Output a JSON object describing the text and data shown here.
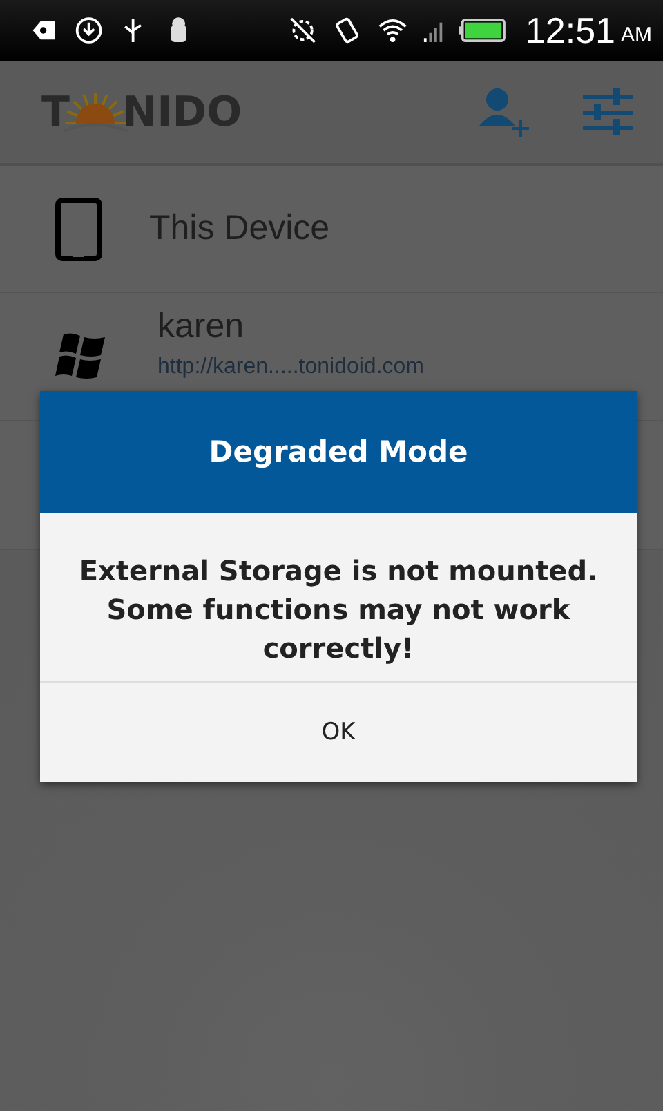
{
  "status_bar": {
    "time": "12:51",
    "meridiem": "AM"
  },
  "app_bar": {
    "logo": {
      "left": "T",
      "right": "NIDO"
    }
  },
  "devices": [
    {
      "kind": "tablet",
      "name": "This Device"
    },
    {
      "kind": "windows",
      "name": "karen",
      "url": "http://karen.....tonidoid.com"
    },
    {
      "kind": "empty"
    }
  ],
  "dialog": {
    "title": "Degraded Mode",
    "message": "External Storage is not mounted. Some functions may not work correctly!",
    "buttons": [
      "OK"
    ]
  }
}
